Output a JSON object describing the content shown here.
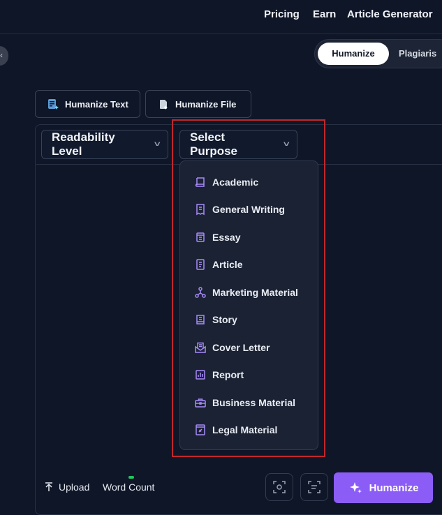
{
  "nav": {
    "pricing": "Pricing",
    "earn": "Earn",
    "article_generator": "Article Generator"
  },
  "mode": {
    "active": "Humanize",
    "other": "Plagiaris"
  },
  "tabs": {
    "text": "Humanize Text",
    "file": "Humanize File"
  },
  "selects": {
    "readability": "Readability Level",
    "purpose": "Select Purpose"
  },
  "purpose_options": [
    {
      "label": "Academic",
      "icon": "book-icon"
    },
    {
      "label": "General Writing",
      "icon": "receipt-icon"
    },
    {
      "label": "Essay",
      "icon": "essay-icon"
    },
    {
      "label": "Article",
      "icon": "article-icon"
    },
    {
      "label": "Marketing Material",
      "icon": "network-icon"
    },
    {
      "label": "Story",
      "icon": "story-book-icon"
    },
    {
      "label": "Cover Letter",
      "icon": "envelope-icon"
    },
    {
      "label": "Report",
      "icon": "report-chart-icon"
    },
    {
      "label": "Business Material",
      "icon": "briefcase-icon"
    },
    {
      "label": "Legal Material",
      "icon": "legal-icon"
    }
  ],
  "bottom": {
    "upload": "Upload",
    "word_count": "Word Count",
    "humanize": "Humanize"
  },
  "colors": {
    "background": "#0f1628",
    "accent": "#8b5cf6",
    "highlight": "#c0272d",
    "icon": "#a78bfa",
    "status": "#22c55e"
  }
}
